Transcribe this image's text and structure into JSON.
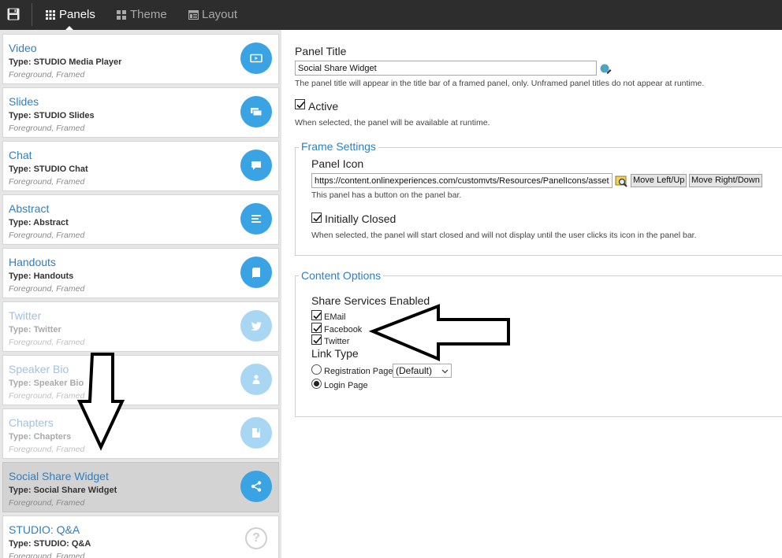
{
  "toolbar": {
    "save_icon": "floppy-disk-icon",
    "tabs": [
      {
        "label": "Panels",
        "icon": "grid-icon"
      },
      {
        "label": "Theme",
        "icon": "palette-icon"
      },
      {
        "label": "Layout",
        "icon": "layout-icon"
      }
    ]
  },
  "sidebar": {
    "panels": [
      {
        "name": "Video",
        "type": "Type: STUDIO Media Player",
        "meta": "Foreground, Framed",
        "icon": "video-icon"
      },
      {
        "name": "Slides",
        "type": "Type: STUDIO Slides",
        "meta": "Foreground, Framed",
        "icon": "slides-icon"
      },
      {
        "name": "Chat",
        "type": "Type: STUDIO Chat",
        "meta": "Foreground, Framed",
        "icon": "chat-bubble-icon"
      },
      {
        "name": "Abstract",
        "type": "Type: Abstract",
        "meta": "Foreground, Framed",
        "icon": "text-lines-icon"
      },
      {
        "name": "Handouts",
        "type": "Type: Handouts",
        "meta": "Foreground, Framed",
        "icon": "document-icon"
      },
      {
        "name": "Twitter",
        "type": "Type: Twitter",
        "meta": "Foreground, Framed",
        "icon": "twitter-bird-icon"
      },
      {
        "name": "Speaker Bio",
        "type": "Type: Speaker Bio",
        "meta": "Foreground, Framed",
        "icon": "person-icon"
      },
      {
        "name": "Chapters",
        "type": "Type: Chapters",
        "meta": "Foreground, Framed",
        "icon": "book-icon"
      },
      {
        "name": "Social Share Widget",
        "type": "Type: Social Share Widget",
        "meta": "Foreground, Framed",
        "icon": "share-icon"
      },
      {
        "name": "STUDIO: Q&A",
        "type": "Type: STUDIO: Q&A",
        "meta": "Foreground, Framed",
        "icon": "question-icon"
      }
    ]
  },
  "form": {
    "panel_title_label": "Panel Title",
    "panel_title_value": "Social Share Widget",
    "panel_title_hint": "The panel title will appear in the title bar of a framed panel, only. Unframed panel titles do not appear at runtime.",
    "active_label": "Active",
    "active_checked": true,
    "active_hint": "When selected, the panel will be available at runtime.",
    "frame_settings": {
      "legend": "Frame Settings",
      "panel_icon_label": "Panel Icon",
      "panel_icon_value": "https://content.onlinexperiences.com/customvts/Resources/PanelIcons/assets",
      "move_left_label": "Move Left/Up",
      "move_right_label": "Move Right/Down",
      "panel_icon_hint": "This panel has a button on the panel bar.",
      "initially_closed_label": "Initially Closed",
      "initially_closed_checked": true,
      "initially_closed_hint": "When selected, the panel will start closed and will not display until the user clicks its icon in the panel bar."
    },
    "content_options": {
      "legend": "Content Options",
      "share_services_label": "Share Services Enabled",
      "services": [
        {
          "label": "EMail",
          "checked": true
        },
        {
          "label": "Facebook",
          "checked": true
        },
        {
          "label": "Twitter",
          "checked": true
        }
      ],
      "link_type_label": "Link Type",
      "link_options": [
        {
          "label": "Registration Page",
          "checked": false
        },
        {
          "label": "Login Page",
          "checked": true
        }
      ],
      "registration_select_value": "(Default)"
    }
  },
  "colors": {
    "topbar": "#2d2d2d",
    "accent_blue": "#3aa3e3",
    "link_blue": "#2f7fc0",
    "selected_row": "#d3d3d3"
  }
}
